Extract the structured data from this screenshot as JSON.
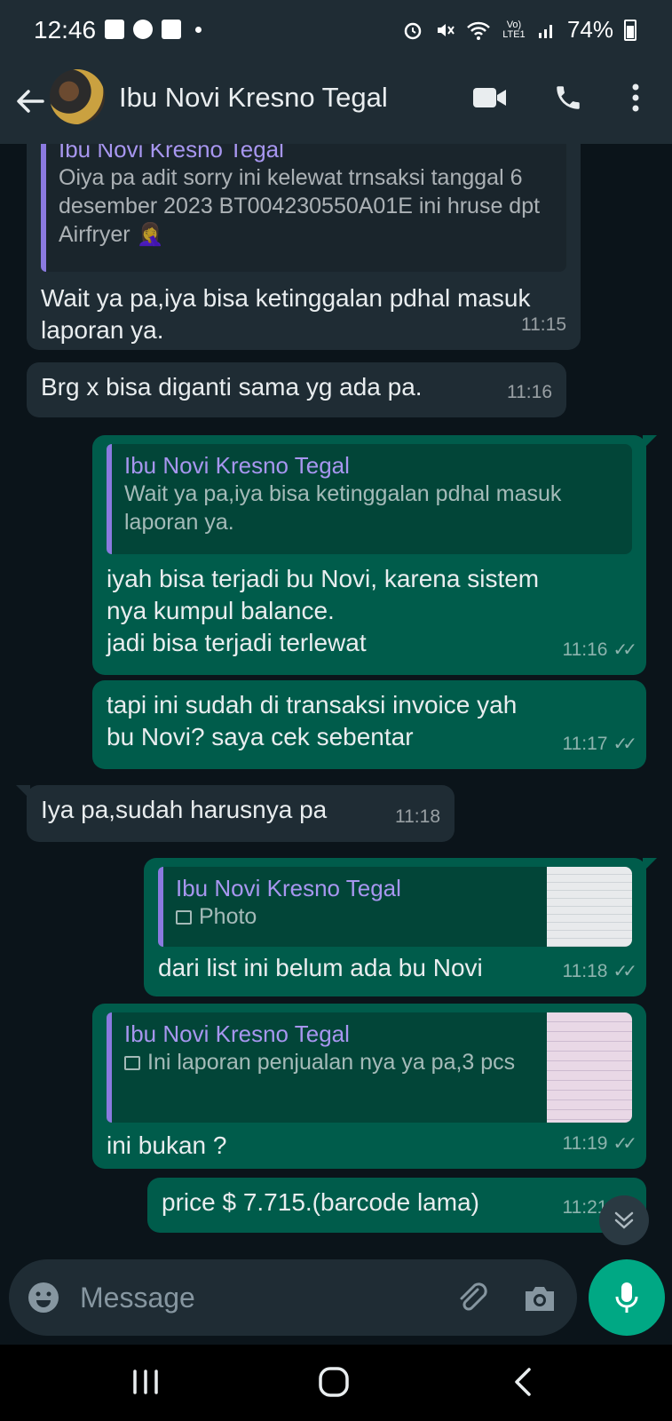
{
  "status_bar": {
    "time": "12:46",
    "battery": "74%",
    "signal_label": "Vo) LTE1"
  },
  "header": {
    "contact_name": "Ibu Novi Kresno Tegal",
    "back_icon": "arrow-left-icon",
    "video_icon": "video-call-icon",
    "call_icon": "phone-icon",
    "menu_icon": "more-vertical-icon"
  },
  "messages": [
    {
      "direction": "in",
      "quote": {
        "author": "Ibu Novi Kresno Tegal",
        "text": "Oiya pa adit sorry ini kelewat trnsaksi tanggal 6 desember 2023 BT004230550A01E ini hruse dpt Airfryer 🤦‍♀️"
      },
      "text": "Wait ya pa,iya bisa ketinggalan pdhal masuk laporan ya.",
      "time": "11:15"
    },
    {
      "direction": "in",
      "text": "Brg x bisa diganti sama yg ada pa.",
      "time": "11:16"
    },
    {
      "direction": "out",
      "quote": {
        "author": "Ibu Novi Kresno Tegal",
        "text": "Wait ya pa,iya bisa ketinggalan pdhal masuk laporan ya."
      },
      "text_lines": [
        "iyah bisa terjadi bu Novi, karena sistem",
        "nya kumpul balance.",
        "jadi bisa terjadi terlewat"
      ],
      "time": "11:16",
      "status": "read"
    },
    {
      "direction": "out",
      "text": "tapi ini sudah di transaksi invoice yah bu Novi? saya cek sebentar",
      "time": "11:17",
      "status": "read"
    },
    {
      "direction": "in",
      "text": "Iya pa,sudah harusnya pa",
      "time": "11:18"
    },
    {
      "direction": "out",
      "quote": {
        "author": "Ibu Novi Kresno Tegal",
        "text": "Photo",
        "has_thumbnail": true
      },
      "text": "dari list ini belum ada bu Novi",
      "time": "11:18",
      "status": "read"
    },
    {
      "direction": "out",
      "quote": {
        "author": "Ibu Novi Kresno Tegal",
        "text": "Ini laporan penjualan nya ya pa,3 pcs",
        "has_thumbnail": true
      },
      "text": "ini bukan ?",
      "time": "11:19",
      "status": "read"
    },
    {
      "direction": "out",
      "text": "price $ 7.715.(barcode lama)",
      "time": "11:21",
      "status": "read"
    }
  ],
  "composer": {
    "placeholder": "Message",
    "emoji_icon": "emoji-icon",
    "attach_icon": "paperclip-icon",
    "camera_icon": "camera-icon",
    "mic_icon": "mic-icon"
  },
  "colors": {
    "background": "#0b141a",
    "header": "#1f2c34",
    "incoming": "#1f2c34",
    "outgoing": "#005c4b",
    "accent": "#00a884",
    "quote_author": "#a796ef"
  }
}
